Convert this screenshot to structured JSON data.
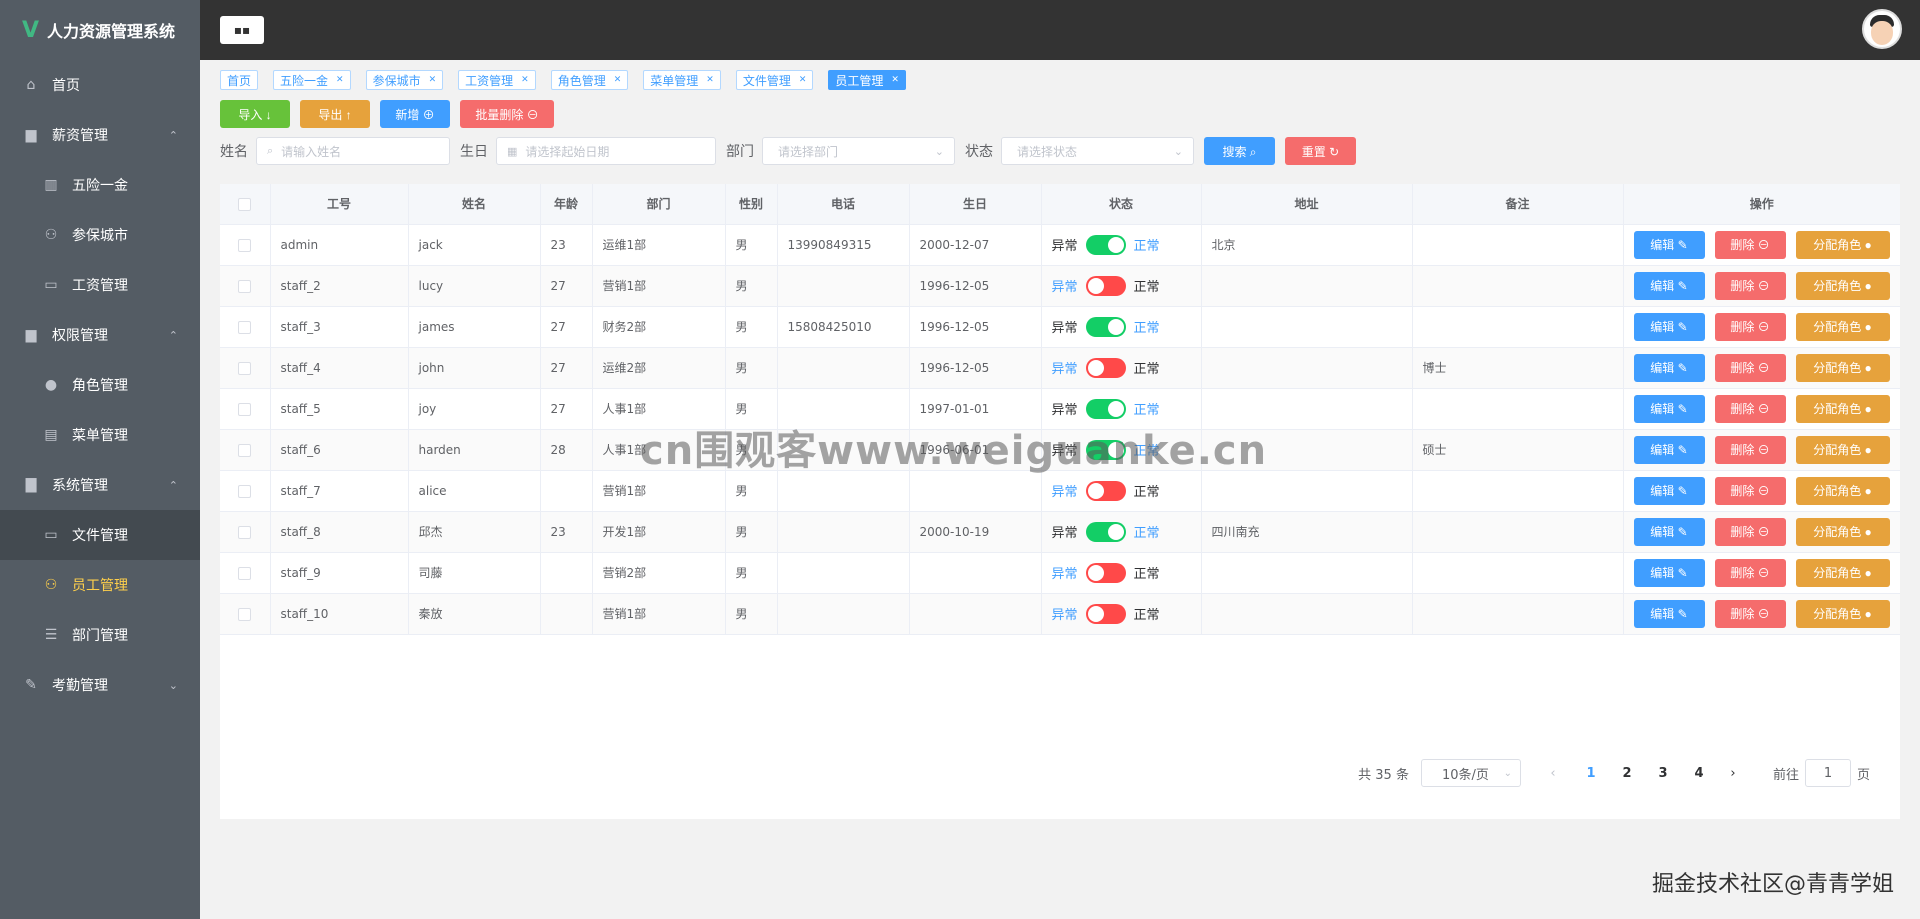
{
  "app": {
    "title": "人力资源管理系统",
    "logo_glyph": "V"
  },
  "sidebar": {
    "items": [
      {
        "label": "首页",
        "icon": "home-icon",
        "glyph": "⌂",
        "type": "top"
      },
      {
        "label": "薪资管理",
        "icon": "briefcase-icon",
        "glyph": "▆",
        "type": "group",
        "arrow": "⌃"
      },
      {
        "label": "五险一金",
        "icon": "bar-chart-icon",
        "glyph": "▥",
        "type": "sub"
      },
      {
        "label": "参保城市",
        "icon": "user-icon",
        "glyph": "⚇",
        "type": "sub"
      },
      {
        "label": "工资管理",
        "icon": "monitor-icon",
        "glyph": "▭",
        "type": "sub"
      },
      {
        "label": "权限管理",
        "icon": "lock-icon",
        "glyph": "▆",
        "type": "group",
        "arrow": "⌃"
      },
      {
        "label": "角色管理",
        "icon": "user-solid-icon",
        "glyph": "●",
        "type": "sub"
      },
      {
        "label": "菜单管理",
        "icon": "document-icon",
        "glyph": "▤",
        "type": "sub"
      },
      {
        "label": "系统管理",
        "icon": "data-icon",
        "glyph": "▇",
        "type": "group",
        "arrow": "⌃"
      },
      {
        "label": "文件管理",
        "icon": "folder-icon",
        "glyph": "▭",
        "type": "sub",
        "highlight": true
      },
      {
        "label": "员工管理",
        "icon": "user-icon",
        "glyph": "⚇",
        "type": "sub",
        "active": true
      },
      {
        "label": "部门管理",
        "icon": "sliders-icon",
        "glyph": "☰",
        "type": "sub"
      },
      {
        "label": "考勤管理",
        "icon": "edit-icon",
        "glyph": "✎",
        "type": "group",
        "arrow": "⌄"
      }
    ]
  },
  "header": {
    "collapse_glyph": "▪▪"
  },
  "tags": [
    {
      "label": "首页",
      "closable": false
    },
    {
      "label": "五险一金",
      "closable": true
    },
    {
      "label": "参保城市",
      "closable": true
    },
    {
      "label": "工资管理",
      "closable": true
    },
    {
      "label": "角色管理",
      "closable": true
    },
    {
      "label": "菜单管理",
      "closable": true
    },
    {
      "label": "文件管理",
      "closable": true
    },
    {
      "label": "员工管理",
      "closable": true,
      "active": true
    }
  ],
  "toolbar": {
    "import_label": "导入 ↓",
    "export_label": "导出 ↑",
    "add_label": "新增 ⊕",
    "batch_delete_label": "批量删除 ⊖"
  },
  "search": {
    "name_label": "姓名",
    "name_placeholder": "请输入姓名",
    "birthday_label": "生日",
    "birthday_placeholder": "请选择起始日期",
    "dept_label": "部门",
    "dept_placeholder": "请选择部门",
    "status_label": "状态",
    "status_placeholder": "请选择状态",
    "search_label": "搜索 ⌕",
    "reset_label": "重置 ↻"
  },
  "table": {
    "headers": [
      "工号",
      "姓名",
      "年龄",
      "部门",
      "性别",
      "电话",
      "生日",
      "状态",
      "地址",
      "备注",
      "操作"
    ],
    "status_off_label": "异常",
    "status_on_label": "正常",
    "edit_label": "编辑 ✎",
    "delete_label": "删除 ⊖",
    "assign_label": "分配角色 ●",
    "rows": [
      {
        "id": "admin",
        "name": "jack",
        "age": "23",
        "dept": "运维1部",
        "gender": "男",
        "phone": "13990849315",
        "birthday": "2000-12-07",
        "on": true,
        "address": "北京",
        "note": ""
      },
      {
        "id": "staff_2",
        "name": "lucy",
        "age": "27",
        "dept": "营销1部",
        "gender": "男",
        "phone": "",
        "birthday": "1996-12-05",
        "on": false,
        "address": "",
        "note": ""
      },
      {
        "id": "staff_3",
        "name": "james",
        "age": "27",
        "dept": "财务2部",
        "gender": "男",
        "phone": "15808425010",
        "birthday": "1996-12-05",
        "on": true,
        "address": "",
        "note": ""
      },
      {
        "id": "staff_4",
        "name": "john",
        "age": "27",
        "dept": "运维2部",
        "gender": "男",
        "phone": "",
        "birthday": "1996-12-05",
        "on": false,
        "address": "",
        "note": "博士"
      },
      {
        "id": "staff_5",
        "name": "joy",
        "age": "27",
        "dept": "人事1部",
        "gender": "男",
        "phone": "",
        "birthday": "1997-01-01",
        "on": true,
        "address": "",
        "note": ""
      },
      {
        "id": "staff_6",
        "name": "harden",
        "age": "28",
        "dept": "人事1部",
        "gender": "男",
        "phone": "",
        "birthday": "1996-06-01",
        "on": true,
        "address": "",
        "note": "硕士"
      },
      {
        "id": "staff_7",
        "name": "alice",
        "age": "",
        "dept": "营销1部",
        "gender": "男",
        "phone": "",
        "birthday": "",
        "on": false,
        "address": "",
        "note": ""
      },
      {
        "id": "staff_8",
        "name": "邱杰",
        "age": "23",
        "dept": "开发1部",
        "gender": "男",
        "phone": "",
        "birthday": "2000-10-19",
        "on": true,
        "address": "四川南充",
        "note": ""
      },
      {
        "id": "staff_9",
        "name": "司藤",
        "age": "",
        "dept": "营销2部",
        "gender": "男",
        "phone": "",
        "birthday": "",
        "on": false,
        "address": "",
        "note": ""
      },
      {
        "id": "staff_10",
        "name": "秦放",
        "age": "",
        "dept": "营销1部",
        "gender": "男",
        "phone": "",
        "birthday": "",
        "on": false,
        "address": "",
        "note": ""
      }
    ]
  },
  "pagination": {
    "total_label": "共 35 条",
    "page_size": "10条/页",
    "prev_glyph": "‹",
    "next_glyph": "›",
    "pages": [
      "1",
      "2",
      "3",
      "4"
    ],
    "current_page": "1",
    "goto_label": "前往",
    "goto_value": "1",
    "page_unit": "页"
  },
  "watermark": "cn围观客www.weiguanke.cn",
  "credit": "掘金技术社区@青青学姐",
  "colors": {
    "sidebar_bg": "#545c64",
    "header_bg": "#333333",
    "primary": "#409eff",
    "success": "#67c23a",
    "warning": "#e6a23c",
    "danger": "#f56c6c",
    "active_menu": "#ffd04b"
  }
}
